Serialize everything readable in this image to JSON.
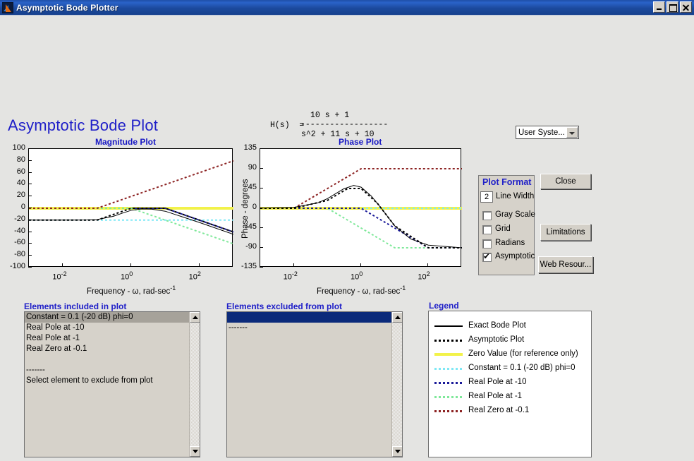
{
  "window": {
    "title": "Asymptotic Bode Plotter",
    "icon": "matlab-flame-icon",
    "minimize_label": "Minimize",
    "maximize_label": "Maximize",
    "close_label": "Close"
  },
  "header": {
    "main_title": "Asymptotic Bode Plot",
    "transfer_function": {
      "lhs": "H(s)  =",
      "numerator": "10 s + 1",
      "bar": "------------------",
      "denominator": "s^2 + 11 s + 10"
    }
  },
  "system_select": {
    "value": "User Syste...",
    "arrow_icon": "chevron-down-icon"
  },
  "plot_format": {
    "title": "Plot Format",
    "line_width_value": "2",
    "line_width_label": "Line Width",
    "checkboxes": [
      {
        "label": "Gray Scale",
        "checked": false
      },
      {
        "label": "Grid",
        "checked": false
      },
      {
        "label": "Radians",
        "checked": false
      },
      {
        "label": "Asymptotic",
        "checked": true
      }
    ]
  },
  "buttons": {
    "close": "Close",
    "limitations": "Limitations",
    "web_resources": "Web Resour..."
  },
  "included_list": {
    "label": "Elements included in plot",
    "items": [
      "Constant = 0.1 (-20 dB) phi=0",
      "Real Pole at -10",
      "Real Pole at -1",
      "Real Zero at -0.1",
      "",
      "-------",
      "Select element to exclude from plot"
    ],
    "selected_index": 0
  },
  "excluded_list": {
    "label": "Elements excluded from plot",
    "items": [
      "",
      "-------"
    ],
    "selected_index": 0
  },
  "legend": {
    "label": "Legend",
    "entries": [
      {
        "text": "Exact Bode Plot",
        "color": "#000000",
        "style": "solid"
      },
      {
        "text": "Asymptotic Plot",
        "color": "#000000",
        "style": "dotted"
      },
      {
        "text": "Zero Value (for reference only)",
        "color": "#f2f24a",
        "style": "solid"
      },
      {
        "text": "Constant = 0.1 (-20 dB) phi=0",
        "color": "#7fe8f5",
        "style": "dotted"
      },
      {
        "text": "Real Pole at -10",
        "color": "#1a1a99",
        "style": "dotted"
      },
      {
        "text": "Real Pole at -1",
        "color": "#7fe89a",
        "style": "dotted"
      },
      {
        "text": "Real Zero at -0.1",
        "color": "#8c2222",
        "style": "dotted"
      }
    ]
  },
  "chart_data": [
    {
      "type": "line",
      "id": "magnitude-plot",
      "title": "Magnitude Plot",
      "xlabel": "Frequency - ω, rad-sec",
      "xlabel_exp": "-1",
      "ylabel": "",
      "xscale": "log",
      "xlim": [
        0.001,
        1000
      ],
      "ylim": [
        -100,
        100
      ],
      "yticks": [
        100,
        80,
        60,
        40,
        20,
        0,
        -20,
        -40,
        -60,
        -80,
        -100
      ],
      "xticks": [
        "10",
        "10",
        "10"
      ],
      "xtick_exps": [
        "-2",
        "0",
        "2"
      ],
      "xtick_values": [
        0.01,
        1,
        100
      ],
      "grid": false,
      "series": [
        {
          "name": "Zero Value (for reference only)",
          "color": "#f2f24a",
          "style": "solid",
          "width": 4,
          "x": [
            0.001,
            1000
          ],
          "y": [
            0,
            0
          ]
        },
        {
          "name": "Constant = 0.1 (-20 dB) phi=0",
          "color": "#7fe8f5",
          "style": "dotted",
          "width": 2,
          "x": [
            0.001,
            1000
          ],
          "y": [
            -20,
            -20
          ]
        },
        {
          "name": "Real Pole at -10",
          "color": "#1a1a99",
          "style": "dotted",
          "width": 2,
          "x": [
            0.001,
            10,
            1000
          ],
          "y": [
            0,
            0,
            -40
          ]
        },
        {
          "name": "Real Pole at -1",
          "color": "#7fe89a",
          "style": "dotted",
          "width": 2,
          "x": [
            0.001,
            1,
            1000
          ],
          "y": [
            0,
            0,
            -60
          ]
        },
        {
          "name": "Real Zero at -0.1",
          "color": "#8c2222",
          "style": "dotted",
          "width": 2,
          "x": [
            0.001,
            0.1,
            1000
          ],
          "y": [
            0,
            0,
            80
          ]
        },
        {
          "name": "Asymptotic Plot",
          "color": "#000000",
          "style": "dotted",
          "width": 2,
          "x": [
            0.001,
            0.1,
            1,
            10,
            1000
          ],
          "y": [
            -20,
            -20,
            0,
            0,
            -40
          ]
        },
        {
          "name": "Exact Bode Plot",
          "color": "#000000",
          "style": "solid",
          "width": 1,
          "x": [
            0.001,
            0.01,
            0.05,
            0.1,
            0.3,
            0.6,
            1,
            2,
            4,
            10,
            30,
            100,
            1000
          ],
          "y": [
            -20,
            -20,
            -19.8,
            -19,
            -13.5,
            -7.5,
            -3.5,
            -1.2,
            -1.5,
            -5,
            -14,
            -24,
            -44
          ]
        }
      ]
    },
    {
      "type": "line",
      "id": "phase-plot",
      "title": "Phase Plot",
      "xlabel": "Frequency - ω, rad-sec",
      "xlabel_exp": "-1",
      "ylabel": "Phase - degrees",
      "xscale": "log",
      "xlim": [
        0.001,
        1000
      ],
      "ylim": [
        -135,
        135
      ],
      "yticks": [
        135,
        90,
        45,
        0,
        -45,
        -90,
        -135
      ],
      "xticks": [
        "10",
        "10",
        "10"
      ],
      "xtick_exps": [
        "-2",
        "0",
        "2"
      ],
      "xtick_values": [
        0.01,
        1,
        100
      ],
      "grid": false,
      "series": [
        {
          "name": "Zero Value (for reference only)",
          "color": "#f2f24a",
          "style": "solid",
          "width": 4,
          "x": [
            0.001,
            1000
          ],
          "y": [
            0,
            0
          ]
        },
        {
          "name": "Constant = 0.1 (-20 dB) phi=0",
          "color": "#7fe8f5",
          "style": "dotted",
          "width": 2,
          "x": [
            0.001,
            1000
          ],
          "y": [
            0,
            0
          ]
        },
        {
          "name": "Real Pole at -1",
          "color": "#7fe89a",
          "style": "dotted",
          "width": 2,
          "x": [
            0.001,
            0.1,
            10,
            1000
          ],
          "y": [
            0,
            0,
            -90,
            -90
          ]
        },
        {
          "name": "Real Pole at -10",
          "color": "#1a1a99",
          "style": "dotted",
          "width": 2,
          "x": [
            0.001,
            1,
            100,
            1000
          ],
          "y": [
            0,
            0,
            -90,
            -90
          ]
        },
        {
          "name": "Real Zero at -0.1",
          "color": "#8c2222",
          "style": "dotted",
          "width": 2,
          "x": [
            0.001,
            0.01,
            1,
            1000
          ],
          "y": [
            0,
            0,
            90,
            90
          ]
        },
        {
          "name": "Asymptotic Plot",
          "color": "#000000",
          "style": "dotted",
          "width": 2,
          "x": [
            0.001,
            0.01,
            0.1,
            0.4,
            1,
            3,
            10,
            100,
            1000
          ],
          "y": [
            0,
            0,
            18,
            45,
            45,
            12,
            -40,
            -90,
            -90
          ]
        },
        {
          "name": "Exact Bode Plot",
          "color": "#000000",
          "style": "solid",
          "width": 1,
          "x": [
            0.001,
            0.01,
            0.05,
            0.1,
            0.3,
            0.6,
            1,
            2,
            4,
            10,
            30,
            100,
            1000
          ],
          "y": [
            0.5,
            2,
            12,
            22,
            44,
            52,
            48,
            28,
            0,
            -40,
            -70,
            -84,
            -90
          ]
        }
      ]
    }
  ]
}
